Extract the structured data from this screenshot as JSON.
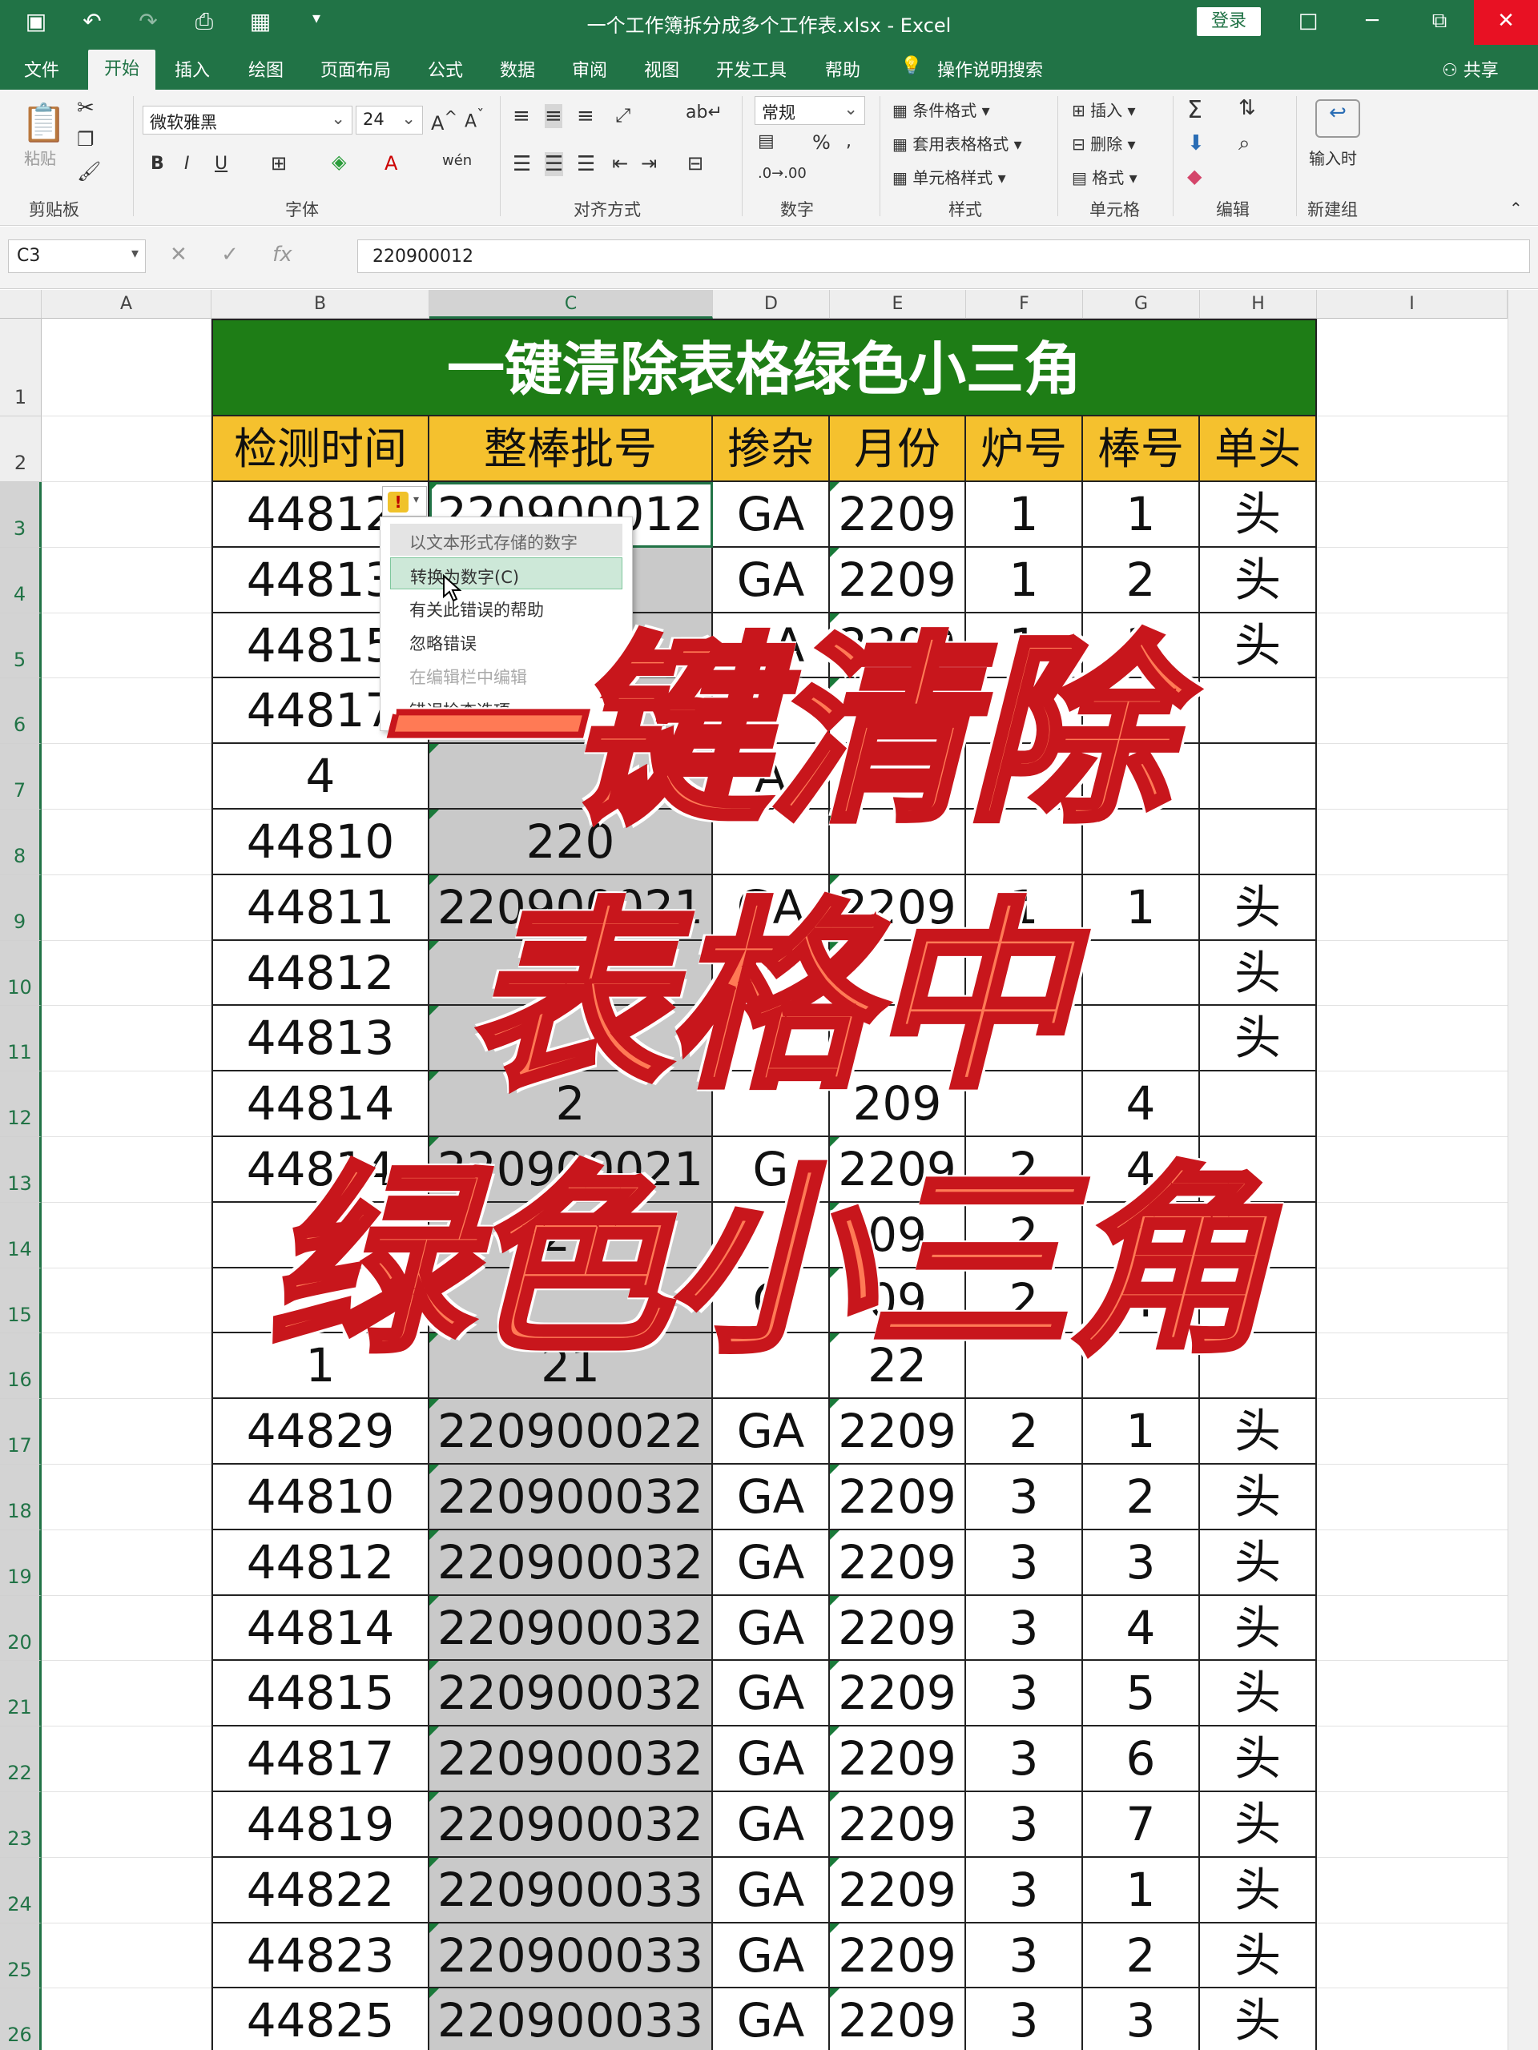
{
  "window": {
    "title": "一个工作簿拆分成多个工作表.xlsx - Excel",
    "login_label": "登录",
    "restore_icon": "□",
    "min_icon": "─",
    "max_icon": "⧉",
    "close_icon": "✕"
  },
  "tabs": {
    "items": [
      "文件",
      "开始",
      "插入",
      "绘图",
      "页面布局",
      "公式",
      "数据",
      "审阅",
      "视图",
      "开发工具",
      "帮助"
    ],
    "search": "操作说明搜索",
    "share": "共享"
  },
  "ribbon": {
    "clipboard": {
      "paste": "粘贴",
      "label": "剪贴板"
    },
    "font": {
      "name": "微软雅黑",
      "size": "24",
      "label": "字体",
      "bold": "B",
      "italic": "I",
      "underline": "U"
    },
    "alignment": {
      "label": "对齐方式"
    },
    "number": {
      "format": "常规",
      "label": "数字",
      "percent": "%"
    },
    "styles": {
      "conditional": "条件格式",
      "table": "套用表格格式",
      "cell": "单元格样式",
      "label": "样式"
    },
    "cells": {
      "insert": "插入",
      "delete": "删除",
      "format": "格式",
      "label": "单元格"
    },
    "editing": {
      "label": "编辑"
    },
    "newgroup": {
      "input": "输入时",
      "label": "新建组"
    }
  },
  "formula_bar": {
    "name_box": "C3",
    "formula": "220900012",
    "cancel": "✕",
    "enter": "✓",
    "fx": "fx"
  },
  "columns": [
    "A",
    "B",
    "C",
    "D",
    "E",
    "F",
    "G",
    "H",
    "I"
  ],
  "rows": [
    "1",
    "2",
    "3",
    "4",
    "5",
    "6",
    "7",
    "8",
    "9",
    "10",
    "11",
    "12",
    "13",
    "14",
    "15",
    "16",
    "17",
    "18",
    "19",
    "20",
    "21",
    "22",
    "23",
    "24",
    "25",
    "26"
  ],
  "sheet": {
    "banner": "一键清除表格绿色小三角",
    "headers": [
      "检测时间",
      "整棒批号",
      "掺杂",
      "月份",
      "炉号",
      "棒号",
      "单头"
    ],
    "data": [
      [
        "44812",
        "220900012",
        "GA",
        "2209",
        "1",
        "1",
        "头"
      ],
      [
        "44813",
        "012",
        "GA",
        "2209",
        "1",
        "2",
        "头"
      ],
      [
        "44815",
        "12",
        "GA",
        "2209",
        "1",
        "3",
        "头"
      ],
      [
        "44817",
        "",
        "",
        "",
        "",
        "",
        ""
      ],
      [
        "4",
        "",
        "A",
        "",
        "",
        "",
        ""
      ],
      [
        "44810",
        "220",
        "",
        "",
        "",
        "",
        ""
      ],
      [
        "44811",
        "220900021",
        "GA",
        "2209",
        "1",
        "1",
        "头"
      ],
      [
        "44812",
        "",
        "",
        "",
        "",
        "",
        "头"
      ],
      [
        "44813",
        "",
        "",
        "",
        "",
        "",
        "头"
      ],
      [
        "44814",
        "2",
        "",
        "209",
        "",
        "4",
        ""
      ],
      [
        "44814",
        "220900021",
        "G",
        "2209",
        "2",
        "4",
        ""
      ],
      [
        "",
        "21",
        "",
        "09",
        "2",
        "4",
        ""
      ],
      [
        "",
        "",
        "G",
        "09",
        "2",
        "4",
        ""
      ],
      [
        "1",
        "21",
        "",
        "22",
        "",
        "",
        ""
      ],
      [
        "44829",
        "220900022",
        "GA",
        "2209",
        "2",
        "1",
        "头"
      ],
      [
        "44810",
        "220900032",
        "GA",
        "2209",
        "3",
        "2",
        "头"
      ],
      [
        "44812",
        "220900032",
        "GA",
        "2209",
        "3",
        "3",
        "头"
      ],
      [
        "44814",
        "220900032",
        "GA",
        "2209",
        "3",
        "4",
        "头"
      ],
      [
        "44815",
        "220900032",
        "GA",
        "2209",
        "3",
        "5",
        "头"
      ],
      [
        "44817",
        "220900032",
        "GA",
        "2209",
        "3",
        "6",
        "头"
      ],
      [
        "44819",
        "220900032",
        "GA",
        "2209",
        "3",
        "7",
        "头"
      ],
      [
        "44822",
        "220900033",
        "GA",
        "2209",
        "3",
        "1",
        "头"
      ],
      [
        "44823",
        "220900033",
        "GA",
        "2209",
        "3",
        "2",
        "头"
      ],
      [
        "44825",
        "220900033",
        "GA",
        "2209",
        "3",
        "3",
        "头"
      ]
    ]
  },
  "context_menu": {
    "items": [
      "以文本形式存储的数字",
      "转换为数字(C)",
      "有关此错误的帮助",
      "忽略错误",
      "在编辑栏中编辑",
      "错误检查选项"
    ]
  },
  "overlay": {
    "line1": "一键清除",
    "line2": "表格中",
    "line3": "绿色小三角"
  },
  "colors": {
    "excel_green": "#217346",
    "banner_bg": "#1e7d16",
    "header_bg": "#f5c12e",
    "selection": "#c9c9c9",
    "overlay_fill": "#ff7a55",
    "overlay_stroke": "#c8161c"
  }
}
